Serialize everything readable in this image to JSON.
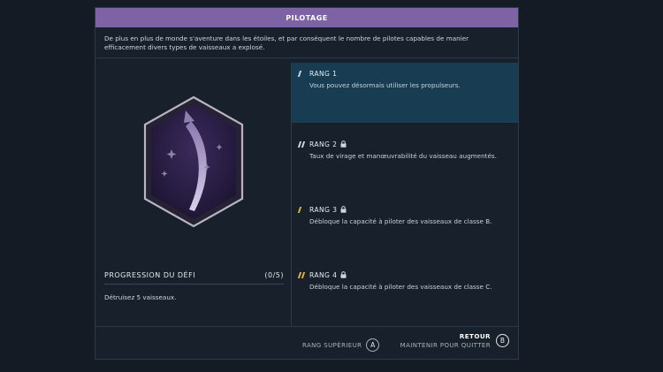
{
  "header": {
    "title": "PILOTAGE"
  },
  "description": "De plus en plus de monde s'aventure dans les étoiles, et par conséquent le nombre de pilotes capables de manier efficacement divers types de vaisseaux a explosé.",
  "challenge": {
    "title": "PROGRESSION DU DÉFI",
    "count": "(0/5)",
    "description": "Détruisez 5 vaisseaux."
  },
  "ranks": [
    {
      "label": "RANG 1",
      "locked": false,
      "selected": true,
      "text": "Vous pouvez désormais utiliser les propulseurs.",
      "bar_count": 1,
      "bar_color": "#cfd6de"
    },
    {
      "label": "RANG 2",
      "locked": true,
      "selected": false,
      "text": "Taux de virage et manœuvrabilité du vaisseau augmentés.",
      "bar_count": 2,
      "bar_color": "#cfd6de"
    },
    {
      "label": "RANG 3",
      "locked": true,
      "selected": false,
      "text": "Débloque la capacité à piloter des vaisseaux de classe B.",
      "bar_count": 1,
      "bar_color": "#e3b23c"
    },
    {
      "label": "RANG 4",
      "locked": true,
      "selected": false,
      "text": "Débloque la capacité à piloter des vaisseaux de classe C.",
      "bar_count": 2,
      "bar_color": "#e3b23c"
    }
  ],
  "footer": {
    "rank_up_label": "RANG SUPÉRIEUR",
    "rank_up_key": "A",
    "back_label": "RETOUR",
    "back_hint": "MAINTENIR POUR QUITTER",
    "back_key": "B"
  },
  "colors": {
    "header": "#7d62a6",
    "selected_rank": "#183d52",
    "accent_gold": "#e3b23c"
  }
}
